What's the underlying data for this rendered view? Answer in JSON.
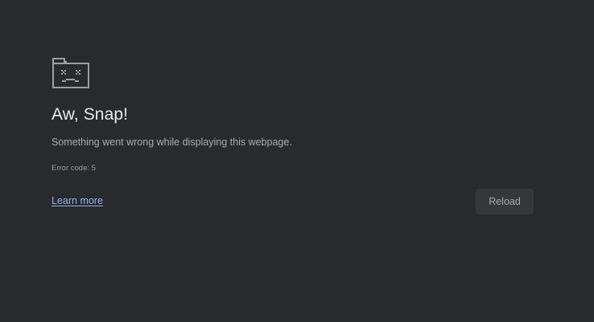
{
  "error_page": {
    "icon": "sad-tab-icon",
    "title": "Aw, Snap!",
    "message": "Something went wrong while displaying this webpage.",
    "error_code": "Error code: 5",
    "learn_more_label": "Learn more",
    "reload_label": "Reload"
  },
  "colors": {
    "background": "#282a2b",
    "title": "#e9eaec",
    "body_text": "#a9acb0",
    "link": "#8ab4f8",
    "button_background": "#353739",
    "icon_stroke": "#9aa0a6"
  }
}
